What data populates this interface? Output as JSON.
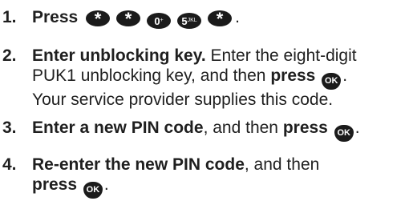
{
  "steps": [
    {
      "number": "1.",
      "action": "Press",
      "keys": [
        {
          "main": "*",
          "sub": "",
          "icon": "star-key-icon"
        },
        {
          "main": "*",
          "sub": "",
          "icon": "star-key-icon"
        },
        {
          "main": "0",
          "sub": "+",
          "icon": "zero-key-icon"
        },
        {
          "main": "5",
          "sub": "JKL",
          "icon": "five-key-icon"
        },
        {
          "main": "*",
          "sub": "",
          "icon": "star-key-icon"
        }
      ],
      "end": "."
    },
    {
      "number": "2.",
      "bold_lead": "Enter unblocking key.",
      "text1": " Enter the eight-digit",
      "text2": "PUK1 unblocking key, and then ",
      "bold_action": "press",
      "ok_key": "OK",
      "end": ".",
      "text3": "Your service provider supplies this code."
    },
    {
      "number": "3.",
      "bold_lead": "Enter a new PIN code",
      "text1": ", and then ",
      "bold_action": "press",
      "ok_key": "OK",
      "end": "."
    },
    {
      "number": "4.",
      "bold_lead": "Re-enter the new PIN code",
      "text1": ", and then",
      "bold_action": "press",
      "ok_key": "OK",
      "end": "."
    }
  ]
}
